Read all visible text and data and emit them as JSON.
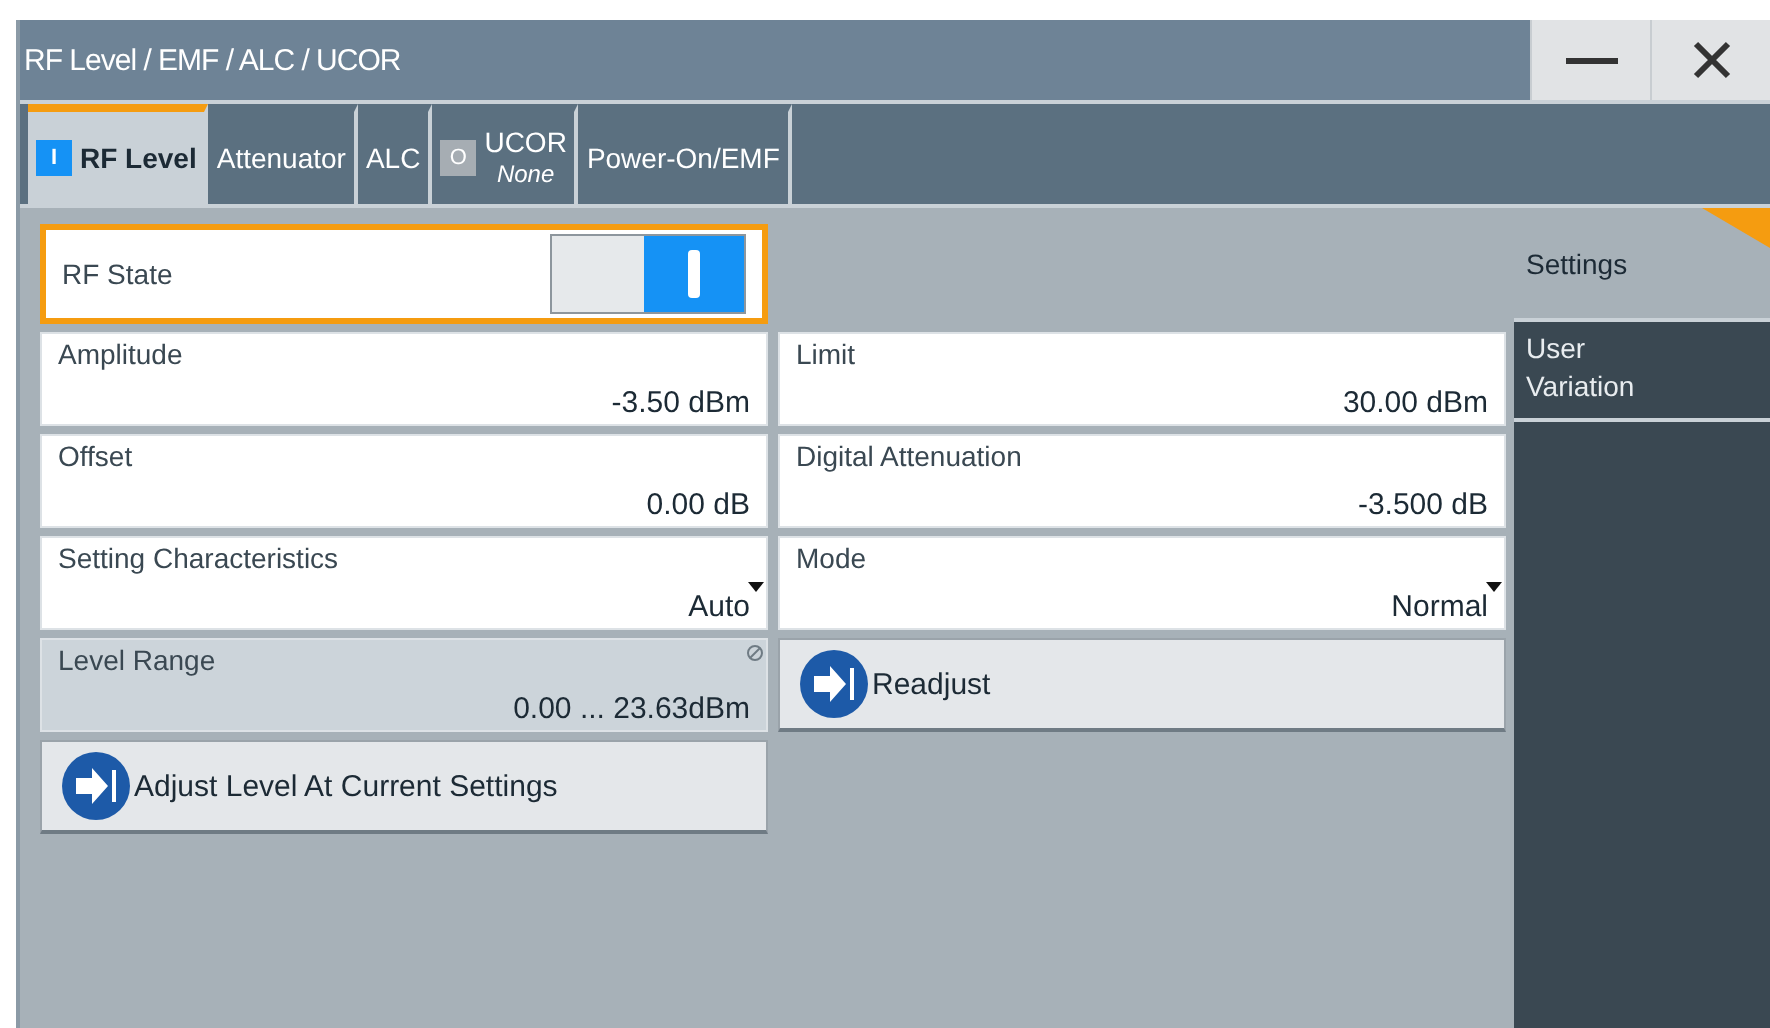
{
  "window": {
    "title": "RF Level / EMF / ALC / UCOR"
  },
  "tabs": [
    {
      "label": "RF Level",
      "selected": true,
      "indicator": {
        "symbol": "I",
        "on": true
      }
    },
    {
      "label": "Attenuator",
      "selected": false
    },
    {
      "label": "ALC",
      "selected": false
    },
    {
      "label": "UCOR",
      "sublabel": "None",
      "selected": false,
      "indicator": {
        "symbol": "O",
        "on": false
      }
    },
    {
      "label": "Power-On/EMF",
      "selected": false
    }
  ],
  "rows": [
    [
      {
        "kind": "toggle",
        "label": "RF State",
        "on": true,
        "focused": true
      }
    ],
    [
      {
        "kind": "value",
        "label": "Amplitude",
        "value": "-3.50 dBm"
      },
      {
        "kind": "value",
        "label": "Limit",
        "value": "30.00 dBm"
      }
    ],
    [
      {
        "kind": "value",
        "label": "Offset",
        "value": "0.00 dB"
      },
      {
        "kind": "value",
        "label": "Digital Attenuation",
        "value": "-3.500 dB"
      }
    ],
    [
      {
        "kind": "dropdown",
        "label": "Setting Characteristics",
        "value": "Auto"
      },
      {
        "kind": "dropdown",
        "label": "Mode",
        "value": "Normal"
      }
    ],
    [
      {
        "kind": "readonly",
        "label": "Level Range",
        "value": "0.00 ... 23.63dBm"
      },
      {
        "kind": "button",
        "label": "Readjust"
      }
    ],
    [
      {
        "kind": "button",
        "label": "Adjust Level At Current Settings"
      }
    ]
  ],
  "sidebar": {
    "title": "Settings",
    "items": [
      {
        "label": "User Variation",
        "selected": false
      }
    ]
  }
}
